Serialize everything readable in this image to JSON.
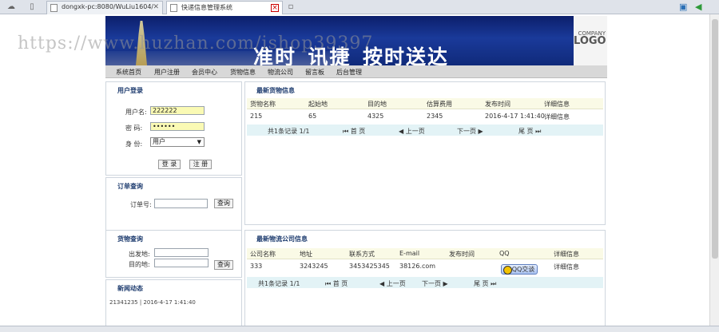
{
  "browser": {
    "tabs": [
      {
        "label": "dongxk-pc:8080/WuLiu1604/",
        "active": false
      },
      {
        "label": "快递信息管理系统",
        "active": true
      }
    ]
  },
  "banner": {
    "slogan": "准时_讯捷_按时送达",
    "logo_small": "COMPANY",
    "logo_big": "LOGO",
    "watermark": "https://www.huzhan.com/ishop39397"
  },
  "nav": [
    "系统首页",
    "用户注册",
    "会员中心",
    "货物信息",
    "物流公司",
    "留言板",
    "后台管理"
  ],
  "login": {
    "title": "用户登录",
    "username_label": "用户名:",
    "username_value": "222222",
    "password_label": "密   码:",
    "password_value": "••••••",
    "role_label": "身   份:",
    "role_value": "用户",
    "login_button": "登 录",
    "register_button": "注 册"
  },
  "order_query": {
    "title": "订单查询",
    "order_label": "订单号:",
    "query_button": "查询"
  },
  "goods_query": {
    "title": "货物查询",
    "from_label": "出发地:",
    "to_label": "目的地:",
    "query_button": "查询"
  },
  "news": {
    "title": "新闻动态",
    "item": "21341235  | 2016-4-17 1:41:40"
  },
  "goods_info": {
    "title": "最新货物信息",
    "columns": [
      "货物名称",
      "起始地",
      "目的地",
      "估算费用",
      "发布时间",
      "详细信息"
    ],
    "rows": [
      [
        "215",
        "65",
        "4325",
        "2345",
        "2016-4-17 1:41:40",
        "详细信息"
      ]
    ],
    "pager": {
      "total": "共1条记录 1/1",
      "first": "首 页",
      "prev": "上一页",
      "next": "下一页",
      "last": "尾 页"
    }
  },
  "company_info": {
    "title": "最新物流公司信息",
    "columns": [
      "公司名称",
      "地址",
      "联系方式",
      "E-mail",
      "发布时间",
      "QQ",
      "详细信息"
    ],
    "rows": [
      [
        "333",
        "3243245",
        "3453425345",
        "38126.com",
        "",
        "QQ交谈",
        "详细信息"
      ]
    ],
    "extra_row_label": "详细信息",
    "pager": {
      "total": "共1条记录 1/1",
      "first": "首 页",
      "prev": "上一页",
      "next": "下一页",
      "last": "尾 页"
    }
  },
  "colors": {
    "banner": "#102a7a",
    "nav": "#d8d8d8",
    "title": "#1d3b6e",
    "pager": "#e3f3f6",
    "header": "#fafae6"
  }
}
